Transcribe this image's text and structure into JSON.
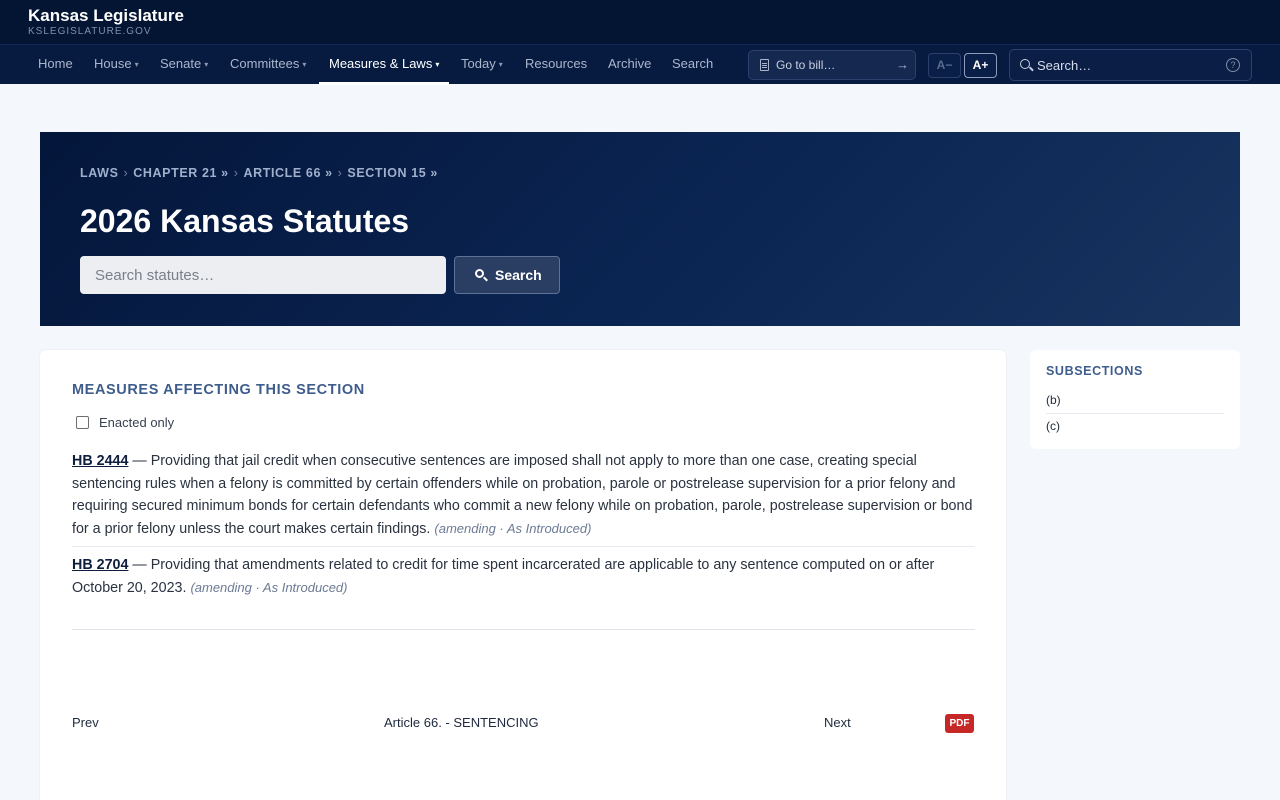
{
  "site": {
    "title": "Kansas Legislature",
    "subtitle": "KSLEGISLATURE.GOV"
  },
  "nav": {
    "items": [
      {
        "label": "Home",
        "dropdown": false
      },
      {
        "label": "House",
        "dropdown": true
      },
      {
        "label": "Senate",
        "dropdown": true
      },
      {
        "label": "Committees",
        "dropdown": true
      },
      {
        "label": "Measures & Laws",
        "dropdown": true,
        "active": true
      },
      {
        "label": "Today",
        "dropdown": true
      },
      {
        "label": "Resources",
        "dropdown": false
      },
      {
        "label": "Archive",
        "dropdown": false
      },
      {
        "label": "Search",
        "dropdown": false
      }
    ],
    "caret": "▾",
    "goto_bill": "Go to bill…",
    "goto_arrow": "→",
    "font_decrease": "A−",
    "font_increase": "A+",
    "search_placeholder": "Search…",
    "help": "?"
  },
  "breadcrumb": {
    "items": [
      "LAWS",
      "CHAPTER 21 »",
      "ARTICLE 66 »",
      "SECTION 15 »"
    ],
    "separator": "›"
  },
  "hero": {
    "title": "2026 Kansas Statutes",
    "search_placeholder": "Search statutes…",
    "search_button": "Search"
  },
  "measures": {
    "heading": "MEASURES AFFECTING THIS SECTION",
    "enacted_only_label": "Enacted only",
    "enacted_only_checked": false,
    "dash": "—",
    "items": [
      {
        "bill": "HB 2444",
        "text": "Providing that jail credit when consecutive sentences are imposed shall not apply to more than one case, creating special sentencing rules when a felony is committed by certain offenders while on probation, parole or postrelease supervision for a prior felony and requiring secured minimum bonds for certain defendants who commit a new felony while on probation, parole, postrelease supervision or bond for a prior felony unless the court makes certain findings.",
        "note": "(amending · As Introduced)"
      },
      {
        "bill": "HB 2704",
        "text": "Providing that amendments related to credit for time spent incarcerated are applicable to any sentence computed on or after October 20, 2023.",
        "note": "(amending · As Introduced)"
      }
    ]
  },
  "pager": {
    "prev": "Prev",
    "article": "Article 66. - SENTENCING",
    "next": "Next",
    "pdf": "PDF"
  },
  "sidebar": {
    "heading": "SUBSECTIONS",
    "items": [
      "(b)",
      "(c)"
    ]
  },
  "colors": {
    "topbar": "#041433",
    "nav": "#071b41",
    "accent": "#3e5d8c",
    "pdf": "#c62828"
  }
}
